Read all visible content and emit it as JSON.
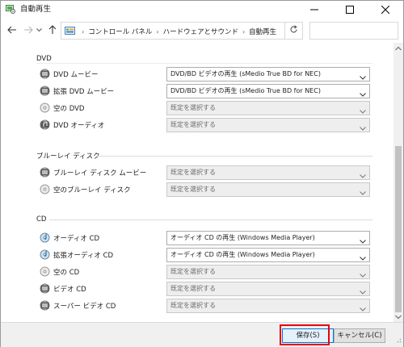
{
  "window": {
    "title": "自動再生",
    "icons": {
      "app": "autoplay-icon",
      "minimize": "minimize-icon",
      "maximize": "maximize-icon",
      "close": "close-icon"
    }
  },
  "navigation": {
    "back_icon": "arrow-left-icon",
    "forward_icon": "arrow-right-icon",
    "recent_icon": "chevron-down-icon",
    "up_icon": "arrow-up-icon",
    "breadcrumbs": [
      "コントロール パネル",
      "ハードウェアとサウンド",
      "自動再生"
    ],
    "refresh_icon": "refresh-icon",
    "search_value": ""
  },
  "sections": [
    {
      "id": "dvd",
      "title": "DVD",
      "items": [
        {
          "label": "DVD ムービー",
          "icon": "dvd-movie-icon",
          "value": "DVD/BD ビデオの再生 (sMedio True BD for NEC)",
          "is_default": false
        },
        {
          "label": "拡張 DVD ムービー",
          "icon": "dvd-movie-icon",
          "value": "DVD/BD ビデオの再生 (sMedio True BD for NEC)",
          "is_default": false
        },
        {
          "label": "空の DVD",
          "icon": "blank-disc-icon",
          "value": "既定を選択する",
          "is_default": true
        },
        {
          "label": "DVD オーディオ",
          "icon": "dvd-audio-icon",
          "value": "既定を選択する",
          "is_default": true
        }
      ]
    },
    {
      "id": "bluray",
      "title": "ブルーレイ ディスク",
      "items": [
        {
          "label": "ブルーレイ ディスク ムービー",
          "icon": "bluray-movie-icon",
          "value": "既定を選択する",
          "is_default": true
        },
        {
          "label": "空のブルーレイ ディスク",
          "icon": "blank-disc-icon",
          "value": "既定を選択する",
          "is_default": true
        }
      ]
    },
    {
      "id": "cd",
      "title": "CD",
      "items": [
        {
          "label": "オーディオ CD",
          "icon": "audio-cd-icon",
          "value": "オーディオ CD の再生 (Windows Media Player)",
          "is_default": false
        },
        {
          "label": "拡張オーディオ CD",
          "icon": "audio-cd-icon",
          "value": "オーディオ CD の再生 (Windows Media Player)",
          "is_default": false
        },
        {
          "label": "空の CD",
          "icon": "blank-disc-icon",
          "value": "既定を選択する",
          "is_default": true
        },
        {
          "label": "ビデオ CD",
          "icon": "video-cd-icon",
          "value": "既定を選択する",
          "is_default": true
        },
        {
          "label": "スーパー ビデオ CD",
          "icon": "video-cd-icon",
          "value": "既定を選択する",
          "is_default": true
        }
      ]
    }
  ],
  "footer": {
    "save_label": "保存(S)",
    "cancel_label": "キャンセル(C)"
  },
  "colors": {
    "accent": "#0078d7",
    "highlight": "#e60012",
    "footer_bg": "#f0f0f0"
  }
}
